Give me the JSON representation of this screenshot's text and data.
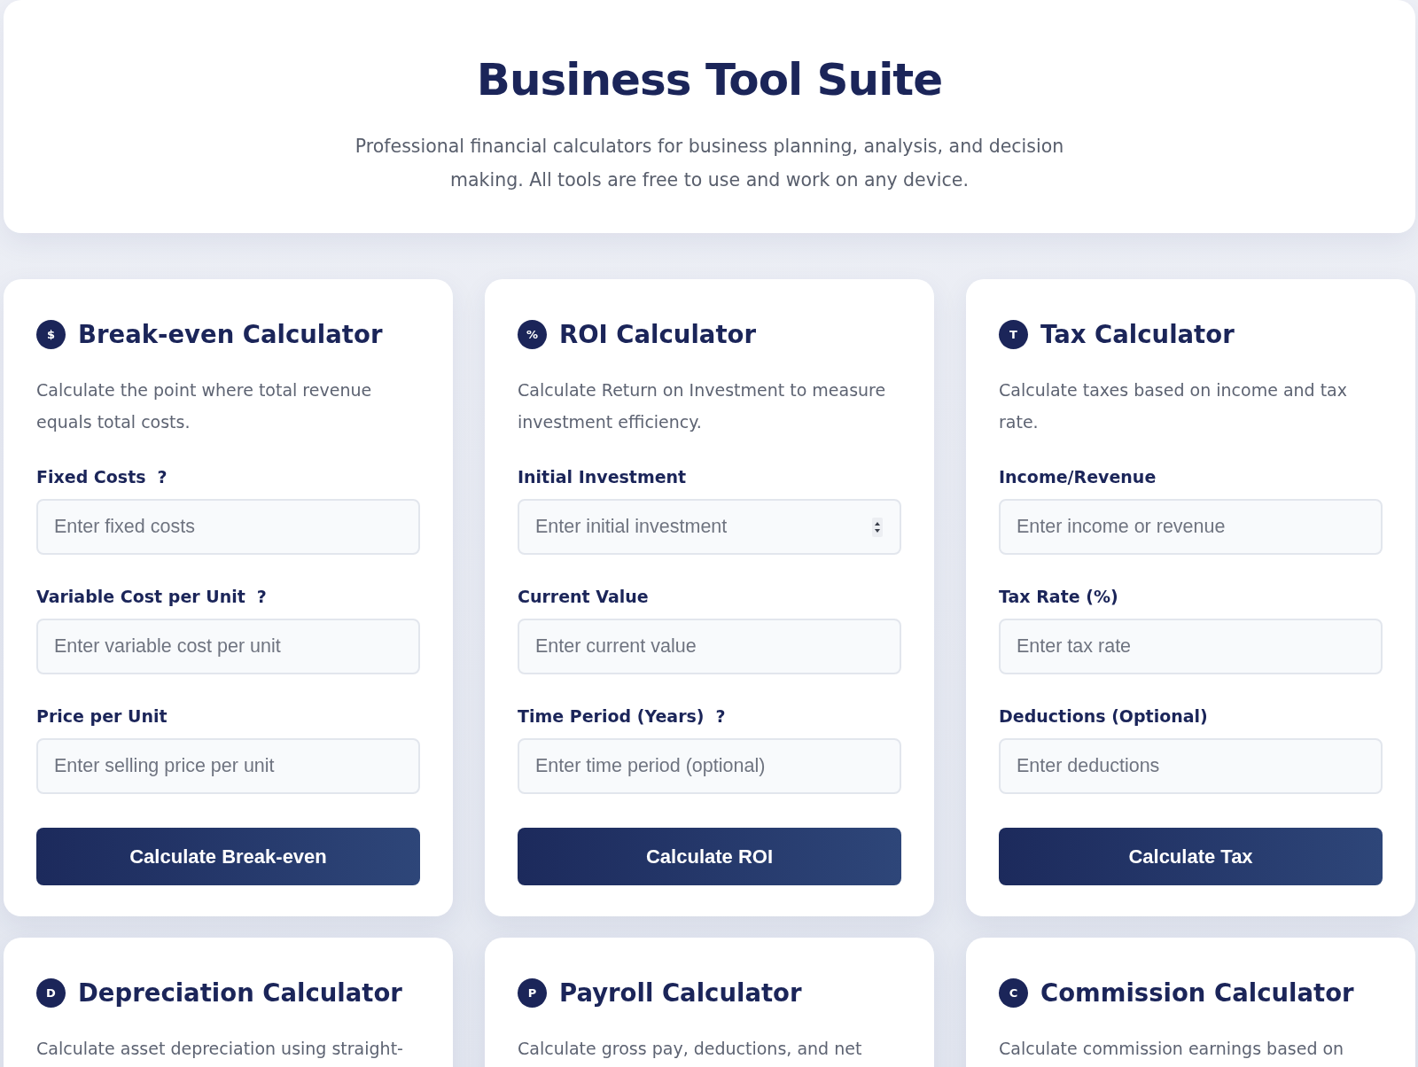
{
  "header": {
    "title": "Business Tool Suite",
    "subtitle": "Professional financial calculators for business planning, analysis, and decision making. All tools are free to use and work on any device."
  },
  "calculators": [
    {
      "icon": "$",
      "title": "Break-even Calculator",
      "description": "Calculate the point where total revenue equals total costs.",
      "fields": [
        {
          "label": "Fixed Costs",
          "help": "?",
          "placeholder": "Enter fixed costs",
          "spinner": false
        },
        {
          "label": "Variable Cost per Unit",
          "help": "?",
          "placeholder": "Enter variable cost per unit",
          "spinner": false
        },
        {
          "label": "Price per Unit",
          "placeholder": "Enter selling price per unit",
          "spinner": false
        }
      ],
      "button": "Calculate Break-even"
    },
    {
      "icon": "%",
      "title": "ROI Calculator",
      "description": "Calculate Return on Investment to measure investment efficiency.",
      "fields": [
        {
          "label": "Initial Investment",
          "placeholder": "Enter initial investment",
          "spinner": true
        },
        {
          "label": "Current Value",
          "placeholder": "Enter current value",
          "spinner": false
        },
        {
          "label": "Time Period (Years)",
          "help": "?",
          "placeholder": "Enter time period (optional)",
          "spinner": false
        }
      ],
      "button": "Calculate ROI"
    },
    {
      "icon": "T",
      "title": "Tax Calculator",
      "description": "Calculate taxes based on income and tax rate.",
      "fields": [
        {
          "label": "Income/Revenue",
          "placeholder": "Enter income or revenue",
          "spinner": false
        },
        {
          "label": "Tax Rate (%)",
          "placeholder": "Enter tax rate",
          "spinner": false
        },
        {
          "label": "Deductions (Optional)",
          "placeholder": "Enter deductions",
          "spinner": false
        }
      ],
      "button": "Calculate Tax"
    },
    {
      "icon": "D",
      "title": "Depreciation Calculator",
      "description": "Calculate asset depreciation using straight-"
    },
    {
      "icon": "P",
      "title": "Payroll Calculator",
      "description": "Calculate gross pay, deductions, and net"
    },
    {
      "icon": "C",
      "title": "Commission Calculator",
      "description": "Calculate commission earnings based on"
    }
  ]
}
